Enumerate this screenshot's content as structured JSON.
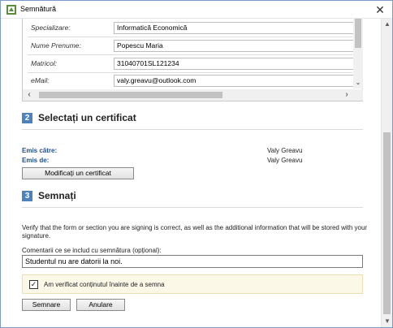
{
  "window": {
    "title": "Semnătură",
    "close": "✕"
  },
  "signature_data": {
    "rows": [
      {
        "label": "Specializare:",
        "value": "Informatică Economică"
      },
      {
        "label": "Nume Prenume:",
        "value": "Popescu Maria"
      },
      {
        "label": "Matricol:",
        "value": "31040701SL121234"
      },
      {
        "label": "eMail:",
        "value": "valy.greavu@outlook.com"
      }
    ]
  },
  "section2": {
    "number": "2",
    "title": "Selectați un certificat",
    "issued_to_label": "Emis către:",
    "issued_to_value": "Valy Greavu",
    "issued_by_label": "Emis de:",
    "issued_by_value": "Valy Greavu",
    "change_cert_button": "Modificați un certificat"
  },
  "section3": {
    "number": "3",
    "title": "Semnați",
    "verify_text": "Verify that the form or section you are signing is correct, as well as the additional information that will be stored with your signature.",
    "comment_label": "Comentarii ce se includ cu semnătura (opțional):",
    "comment_value": "Studentul nu are datorii la noi.",
    "checkbox_label": "Am verificat conținutul înainte de a semna",
    "checkbox_checked": true
  },
  "buttons": {
    "sign": "Semnare",
    "cancel": "Anulare"
  },
  "colors": {
    "section_number_bg": "#4f81bd",
    "emis_label": "#1f4e8c",
    "check_panel_bg": "#fcf8e8"
  }
}
